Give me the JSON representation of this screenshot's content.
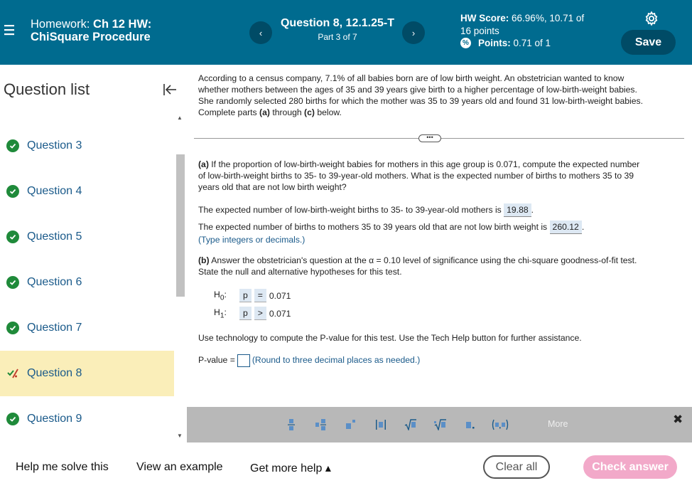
{
  "header": {
    "hw_prefix": "Homework:",
    "hw_title": "Ch 12 HW:",
    "hw_subtitle": "ChiSquare Procedure",
    "question_title": "Question 8, 12.1.25-T",
    "question_part": "Part 3 of 7",
    "prev_glyph": "‹",
    "next_glyph": "›",
    "score_label": "HW Score:",
    "score_value": "66.96%, 10.71 of",
    "score_value2": "16 points",
    "points_label": "Points:",
    "points_value": "0.71 of 1",
    "save_label": "Save"
  },
  "sidebar": {
    "title": "Question list",
    "items": [
      {
        "label": "Question 3",
        "status": "correct"
      },
      {
        "label": "Question 4",
        "status": "correct"
      },
      {
        "label": "Question 5",
        "status": "correct"
      },
      {
        "label": "Question 6",
        "status": "correct"
      },
      {
        "label": "Question 7",
        "status": "correct"
      },
      {
        "label": "Question 8",
        "status": "partial"
      },
      {
        "label": "Question 9",
        "status": "correct"
      }
    ]
  },
  "question": {
    "intro_1": "According to a census company, 7.1% of all babies born are of low birth weight. An obstetrician wanted to know",
    "intro_2": "whether mothers between the ages of 35 and 39 years give birth to a higher percentage of low-birth-weight babies.",
    "intro_3": "She randomly selected 280 births for which the mother was 35 to 39 years old and found 31 low-birth-weight babies.",
    "intro_4a": "Complete parts ",
    "intro_4b": "(a)",
    "intro_4c": " through ",
    "intro_4d": "(c)",
    "intro_4e": " below.",
    "dots": "•••",
    "part_a_label": "(a)",
    "part_a_1": " If the proportion of low-birth-weight babies for mothers in this age group is 0.071, compute the expected number",
    "part_a_2": "of low-birth-weight births to 35- to 39-year-old mothers. What is the expected number of births to mothers 35 to 39",
    "part_a_3": "years old that are not low birth weight?",
    "exp_low_text": "The expected number of low-birth-weight births to 35- to 39-year-old mothers is",
    "exp_low_value": "19.88",
    "exp_not_text": "The expected number of births to mothers 35 to 39 years old that are not low birth weight is",
    "exp_not_value": "260.12",
    "type_hint": "(Type integers or decimals.)",
    "part_b_label": "(b)",
    "part_b_1a": " Answer the obstetrician's question at the ",
    "part_b_alpha": "α",
    "part_b_1b": " = 0.10 level of significance using the chi-square goodness-of-fit test.",
    "part_b_2": "State the null and alternative hypotheses for this test.",
    "h0_label": "H",
    "h0_sub": "0",
    "h0_param": "p",
    "h0_op": "=",
    "h0_value": "0.071",
    "h1_label": "H",
    "h1_sub": "1",
    "h1_param": "p",
    "h1_op": ">",
    "h1_value": "0.071",
    "tech_text": "Use technology to compute the P-value for this test. Use the Tech Help button for further assistance.",
    "pvalue_label": "P-value =",
    "pvalue_hint": "(Round to three decimal places as needed.)"
  },
  "toolbar": {
    "more_label": "More",
    "close_glyph": "✖"
  },
  "footer": {
    "help_label": "Help me solve this",
    "example_label": "View an example",
    "more_help_label": "Get more help ▴",
    "clear_label": "Clear all",
    "check_label": "Check answer"
  },
  "colors": {
    "header_bg": "#006b8f",
    "accent_dark": "#004b66",
    "active_item": "#faeeb9",
    "check_green": "#1f8a3a",
    "check_answer_pink": "#f2a9c9"
  }
}
